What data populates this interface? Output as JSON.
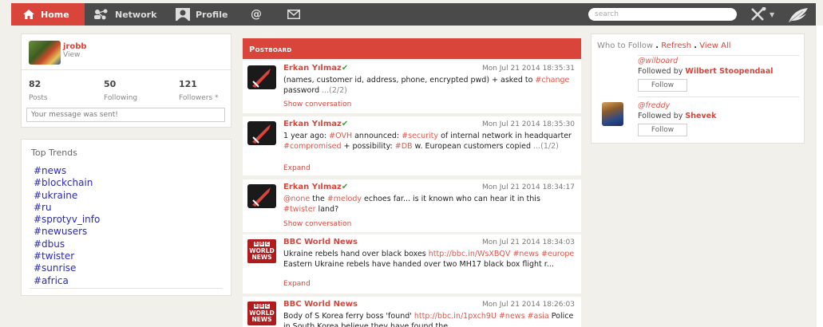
{
  "nav": {
    "home": "Home",
    "network": "Network",
    "profile": "Profile",
    "mentions_symbol": "@",
    "search_placeholder": "search"
  },
  "profile": {
    "nick": "jrobb",
    "view": "View",
    "stats": [
      {
        "num": "82",
        "label": "Posts"
      },
      {
        "num": "50",
        "label": "Following"
      },
      {
        "num": "121",
        "label": "Followers *"
      }
    ],
    "message_status": "Your message was sent!"
  },
  "trends": {
    "title": "Top Trends",
    "items": [
      "#news",
      "#blockchain",
      "#ukraine",
      "#ru",
      "#sprotyv_info",
      "#newusers",
      "#dbus",
      "#twister",
      "#sunrise",
      "#africa"
    ]
  },
  "postboard": {
    "title": "Postboard",
    "posts": [
      {
        "author": "Erkan Yılmaz",
        "time": "Mon Jul 21 2014 18:35:31",
        "action": "Show conversation"
      },
      {
        "author": "Erkan Yılmaz",
        "time": "Mon Jul 21 2014 18:35:30",
        "action": "Expand"
      },
      {
        "author": "Erkan Yılmaz",
        "time": "Mon Jul 21 2014 18:34:17",
        "action": "Show conversation"
      },
      {
        "author": "BBC World News",
        "time": "Mon Jul 21 2014 18:34:03",
        "action": "Expand"
      },
      {
        "author": "BBC World News",
        "time": "Mon Jul 21 2014 18:26:03",
        "action": ""
      }
    ],
    "post_texts": {
      "p1_a": "(names, customer id, address, phone, encrypted pwd) + asked to ",
      "p1_tag": "#change",
      "p1_b": " password ",
      "p1_dim": "...(2/2)",
      "p2_a": "1 year ago: ",
      "p2_tag1": "#OVH",
      "p2_b": " announced: ",
      "p2_tag2": "#security",
      "p2_c": " of internal network in headquarter ",
      "p2_tag3": "#compromised",
      "p2_d": " + possibility: ",
      "p2_tag4": "#DB",
      "p2_e": " w. European customers copied ",
      "p2_dim": "...(1/2)",
      "p3_tag1": "@none",
      "p3_a": " the ",
      "p3_tag2": "#melody",
      "p3_b": " echoes far... is it known who can hear it in this ",
      "p3_tag3": "#twister",
      "p3_c": " land?",
      "p4_a": "Ukraine rebels hand over black boxes ",
      "p4_link": "http://bbc.in/WsXBQV",
      "p4_sp1": " ",
      "p4_tag1": "#news",
      "p4_sp2": " ",
      "p4_tag2": "#europe",
      "p4_b": " Eastern Ukraine rebels have handed over two MH17 black box flight r...",
      "p5_a": "Body of S Korea ferry boss 'found' ",
      "p5_link": "http://bbc.in/1pxch9U",
      "p5_sp1": " ",
      "p5_tag1": "#news",
      "p5_sp2": " ",
      "p5_tag2": "#asia",
      "p5_b": " Police in South Korea believe they have found the"
    },
    "bbc_logo": {
      "b1": "B",
      "b2": "B",
      "b3": "C",
      "world": "WORLD",
      "news": "NEWS"
    }
  },
  "who_to_follow": {
    "title": "Who to Follow",
    "sep": ".",
    "refresh": "Refresh",
    "view_all": "View All",
    "suggestions": [
      {
        "handle": "@wilboard",
        "followed_by": "Followed by",
        "by_name": "Wilbert Stoopendaal",
        "button": "Follow"
      },
      {
        "handle": "@freddy",
        "followed_by": "Followed by",
        "by_name": "Shevek",
        "button": "Follow"
      }
    ]
  },
  "colors": {
    "accent": "#d9453b",
    "topbar": "#4a4a4a",
    "background": "#f2f0eb",
    "trend_link": "#2a2ab8"
  }
}
